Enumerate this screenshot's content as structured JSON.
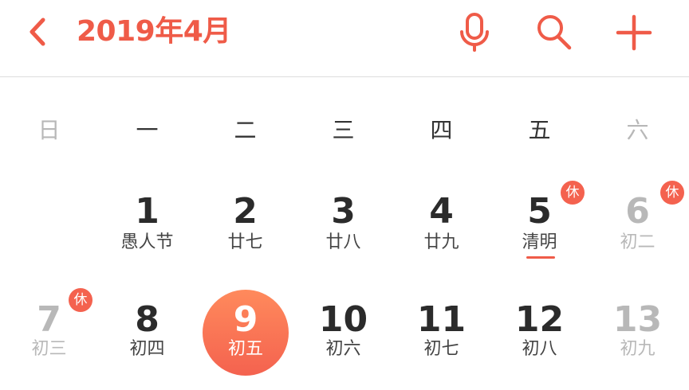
{
  "header": {
    "title": "2019年4月",
    "icons": [
      "back-chevron-icon",
      "microphone-icon",
      "search-icon",
      "plus-icon"
    ],
    "accent_color": "#ef5b48"
  },
  "weekdays": [
    "日",
    "一",
    "二",
    "三",
    "四",
    "五",
    "六"
  ],
  "calendar": {
    "rows": [
      [
        {
          "day": "",
          "lunar": ""
        },
        {
          "day": "1",
          "lunar": "愚人节"
        },
        {
          "day": "2",
          "lunar": "廿七"
        },
        {
          "day": "3",
          "lunar": "廿八"
        },
        {
          "day": "4",
          "lunar": "廿九"
        },
        {
          "day": "5",
          "lunar": "清明",
          "badge": "休",
          "festival_underline": true
        },
        {
          "day": "6",
          "lunar": "初二",
          "badge": "休"
        }
      ],
      [
        {
          "day": "7",
          "lunar": "初三",
          "badge": "休"
        },
        {
          "day": "8",
          "lunar": "初四"
        },
        {
          "day": "9",
          "lunar": "初五",
          "today": true
        },
        {
          "day": "10",
          "lunar": "初六"
        },
        {
          "day": "11",
          "lunar": "初七"
        },
        {
          "day": "12",
          "lunar": "初八"
        },
        {
          "day": "13",
          "lunar": "初九"
        }
      ]
    ],
    "holiday_badge_color": "#f4624f",
    "today_color": "#f4624f"
  }
}
